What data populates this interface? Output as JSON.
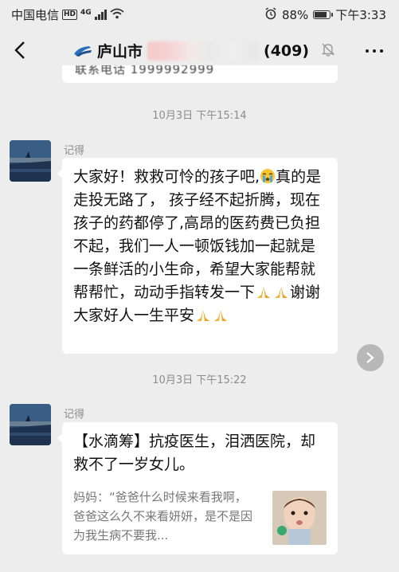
{
  "status_bar": {
    "carrier": "中国电信",
    "hd_badge": "HD",
    "network": "4G",
    "battery_percent": "88%",
    "time": "下午3:33"
  },
  "header": {
    "title_prefix": "庐山市",
    "title_count": "(409)",
    "icons": [
      "back-arrow-icon",
      "group-chat-icon",
      "mute-bell-icon",
      "more-icon"
    ]
  },
  "previous_message": {
    "partial_text": "联系电话 1999992999"
  },
  "messages": [
    {
      "time": "10月3日 下午15:14",
      "sender": "记得",
      "text_line1_pre": "大家好！救救可怜的孩子吧,",
      "text_line1_post": "真",
      "text_body": "的是走投无路了， 孩子经不起折腾，现在孩子的药都停了,高昂的医药费已负担不起，我们一人一顿饭钱加一起就是一条鲜活的小生命，希望大家能帮就帮帮忙，动动手指转发一下",
      "text_tail_mid": "谢谢大家好人一生平安",
      "emoji": [
        "crying-face-icon",
        "praying-hands-icon"
      ]
    },
    {
      "time": "10月3日 下午15:22",
      "sender": "记得",
      "link_title": "【水滴筹】抗疫医生，泪洒医院，却救不了一岁女儿。",
      "link_desc": "妈妈：“爸爸什么时候来看我啊，爸爸这么久不来看妍妍，是不是因为我生病不要我..."
    }
  ],
  "colors": {
    "background": "#ededed",
    "bubble": "#ffffff",
    "timestamp": "#8c8c8c",
    "forward_button": "#b8b8b8"
  }
}
